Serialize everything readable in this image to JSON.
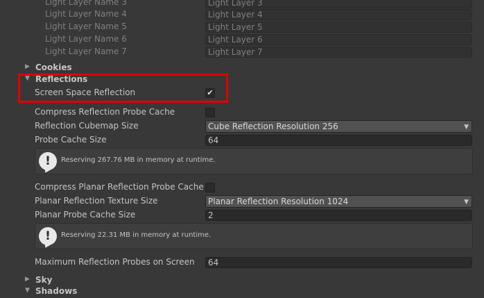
{
  "light_layers": [
    {
      "name_label": "Light Layer Name 3",
      "value": "Light Layer 3"
    },
    {
      "name_label": "Light Layer Name 4",
      "value": "Light Layer 4"
    },
    {
      "name_label": "Light Layer Name 5",
      "value": "Light Layer 5"
    },
    {
      "name_label": "Light Layer Name 6",
      "value": "Light Layer 6"
    },
    {
      "name_label": "Light Layer Name 7",
      "value": "Light Layer 7"
    }
  ],
  "sections": {
    "cookies": "Cookies",
    "reflections": "Reflections",
    "sky": "Sky",
    "shadows": "Shadows"
  },
  "reflections": {
    "ssr_label": "Screen Space Reflection",
    "ssr_checked": true,
    "compress_probe_label": "Compress Reflection Probe Cache",
    "compress_probe_checked": false,
    "cubemap_size_label": "Reflection Cubemap Size",
    "cubemap_size_value": "Cube Reflection Resolution 256",
    "probe_cache_label": "Probe Cache Size",
    "probe_cache_value": "64",
    "probe_cache_help": "Reserving 267.76 MB in memory at runtime.",
    "compress_planar_label": "Compress Planar Reflection Probe Cache",
    "compress_planar_checked": false,
    "planar_texture_label": "Planar Reflection Texture Size",
    "planar_texture_value": "Planar Reflection Resolution 1024",
    "planar_cache_label": "Planar Probe Cache Size",
    "planar_cache_value": "2",
    "planar_cache_help": "Reserving 22.31 MB in memory at runtime.",
    "max_probes_label": "Maximum Reflection Probes on Screen",
    "max_probes_value": "64"
  },
  "icons": {
    "warning": "!",
    "check": "✔",
    "dropdown": "▼",
    "collapsed": "▶",
    "expanded": "▼"
  },
  "colors": {
    "highlight": "#e00000",
    "background": "#383838"
  }
}
